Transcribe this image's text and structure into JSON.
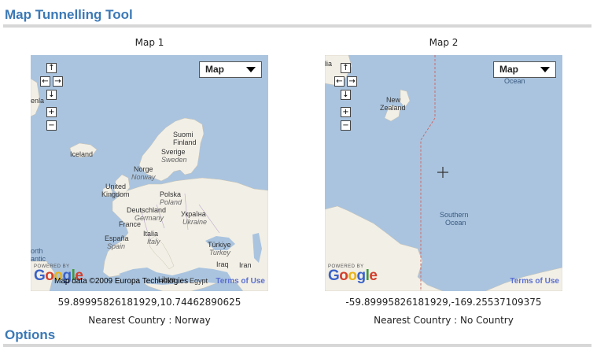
{
  "header": {
    "title": "Map Tunnelling Tool"
  },
  "map1": {
    "title": "Map 1",
    "maptype": "Map",
    "labels": {
      "ocean_edge": "enla",
      "iceland": "Iceland",
      "suomi": "Suomi",
      "finland": "Finland",
      "sverige": "Sverige",
      "sweden": "Sweden",
      "norge": "Norge",
      "norway": "Norway",
      "uk1": "United",
      "uk2": "Kingdom",
      "polska": "Polska",
      "poland": "Poland",
      "deutschland": "Deutschland",
      "germany": "Germany",
      "ukraina": "Україна",
      "ukraine": "Ukraine",
      "france": "France",
      "italia": "Italia",
      "italy": "Italy",
      "espana": "España",
      "spain": "Spain",
      "turkiye": "Türkiye",
      "turkey": "Turkey",
      "iraq": "Iraq",
      "iran": "Iran",
      "north": "orth",
      "atlantic": "antic",
      "libya": "Libya",
      "egypt": "Egypt"
    },
    "powered_by": "POWERED BY",
    "google": "Google",
    "map_data": "Map data ©2009 Europa Technologies",
    "terms": "Terms of Use",
    "coord": "59.89995826181929,10.74462890625",
    "nearest": "Nearest Country : Norway"
  },
  "map2": {
    "title": "Map 2",
    "maptype": "Map",
    "labels": {
      "lia": "lia",
      "ocean_top": "Ocean",
      "new": "New",
      "zealand": "Zealand",
      "southern": "Southern",
      "ocean": "Ocean"
    },
    "powered_by": "POWERED BY",
    "google": "Google",
    "terms": "Terms of Use",
    "coord": "-59.89995826181929,-169.25537109375",
    "nearest": "Nearest Country : No Country"
  },
  "nav": {
    "up": "↑",
    "left": "←",
    "right": "→",
    "down": "↓",
    "zoom_in": "+",
    "zoom_out": "−"
  },
  "options": {
    "title": "Options"
  },
  "colors": {
    "title": "#3b79b6",
    "water": "#aac4df",
    "land": "#f2efe6",
    "terms_link": "#5a6fd0",
    "google_blue": "#3a62c9",
    "google_red": "#d33f2c",
    "google_yellow": "#e9b31b",
    "google_green": "#3e9a3f"
  }
}
